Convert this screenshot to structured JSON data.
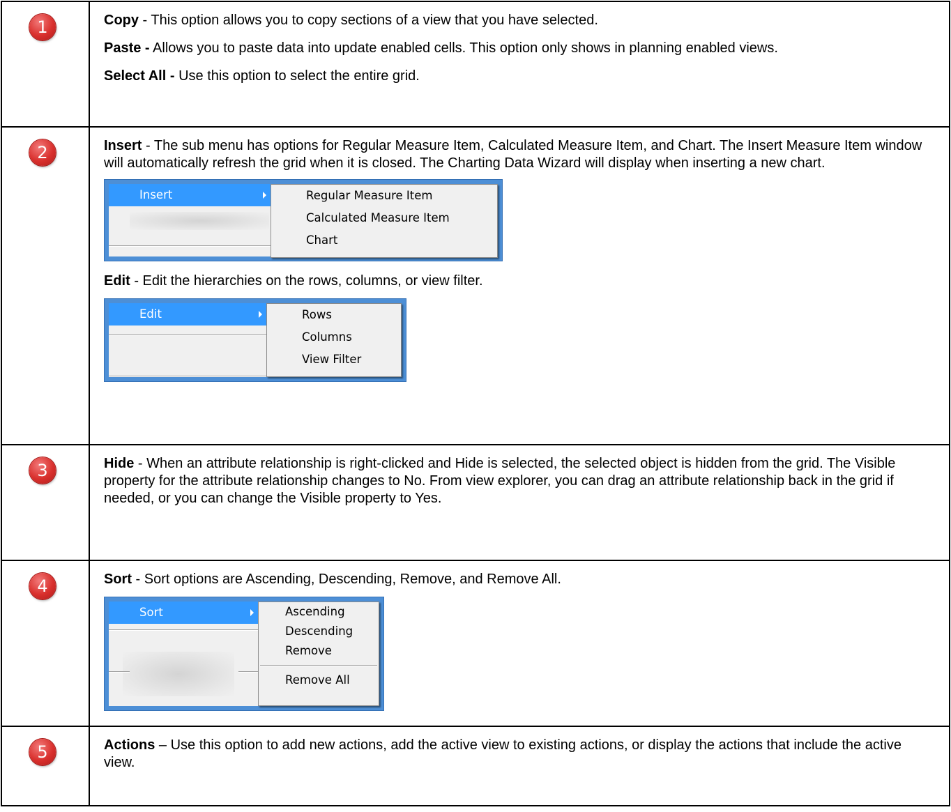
{
  "rows": [
    {
      "number": "1",
      "paragraphs": [
        {
          "term": "Copy",
          "text": " - This option allows you to copy sections of a view that you have selected."
        },
        {
          "term": "Paste -",
          "text": " Allows you to paste data into update enabled cells. This option only shows in planning enabled views."
        },
        {
          "term": "Select All -",
          "text": " Use this option to select the entire grid."
        }
      ]
    },
    {
      "number": "2",
      "insert": {
        "term": "Insert",
        "text": " - The sub menu has options for Regular Measure Item, Calculated Measure Item, and Chart. The Insert Measure Item window will automatically refresh the grid when it is closed. The Charting Data Wizard will display when inserting a new chart.",
        "menu": {
          "selected": "Insert",
          "items": [
            "Regular Measure Item",
            "Calculated Measure Item",
            "Chart"
          ]
        }
      },
      "edit": {
        "term": "Edit",
        "text": " - Edit the hierarchies on the rows, columns, or view filter.",
        "menu": {
          "selected": "Edit",
          "items": [
            "Rows",
            "Columns",
            "View Filter"
          ]
        }
      }
    },
    {
      "number": "3",
      "term": "Hide",
      "text": " - When an attribute relationship is right-clicked and Hide is selected, the selected object is hidden from the grid. The Visible property for the attribute relationship changes to No. From view explorer, you can drag an attribute relationship back in the grid if needed, or you can change the Visible property to Yes."
    },
    {
      "number": "4",
      "term": "Sort",
      "text": " - Sort options are Ascending, Descending, Remove, and Remove All.",
      "menu": {
        "selected": "Sort",
        "items": [
          "Ascending",
          "Descending",
          "Remove"
        ],
        "after_separator": "Remove All"
      }
    },
    {
      "number": "5",
      "term": "Actions",
      "text": " – Use this option to add new actions, add the active view to existing actions, or display the actions that include the active view."
    }
  ],
  "colors": {
    "badge": "#d9302d",
    "menu_highlight": "#3399ff",
    "menu_frame": "#4d8fd6"
  }
}
